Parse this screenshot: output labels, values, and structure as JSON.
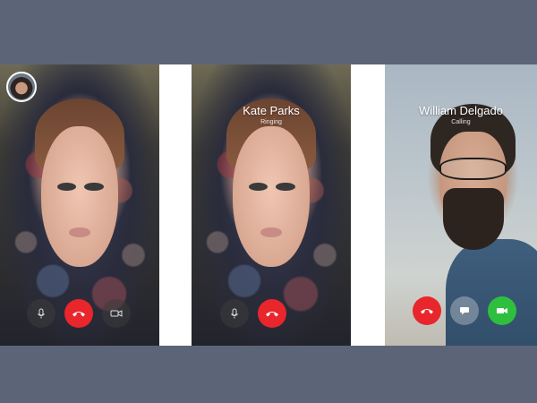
{
  "screens": [
    {
      "id": "in-call",
      "controls": [
        "microphone-icon",
        "hang-up-icon",
        "video-icon"
      ]
    },
    {
      "id": "ringing",
      "caller_name": "Kate Parks",
      "status": "Ringing",
      "controls": [
        "microphone-icon",
        "hang-up-icon"
      ]
    },
    {
      "id": "incoming",
      "caller_name": "William Delgado",
      "status": "Calling",
      "controls": [
        "hang-up-icon",
        "message-icon",
        "video-accept-icon"
      ]
    }
  ],
  "colors": {
    "backdrop": "#5b6577",
    "hang_up": "#e8262c",
    "accept": "#2fbf3f",
    "control_dark": "#3c3c3c"
  }
}
